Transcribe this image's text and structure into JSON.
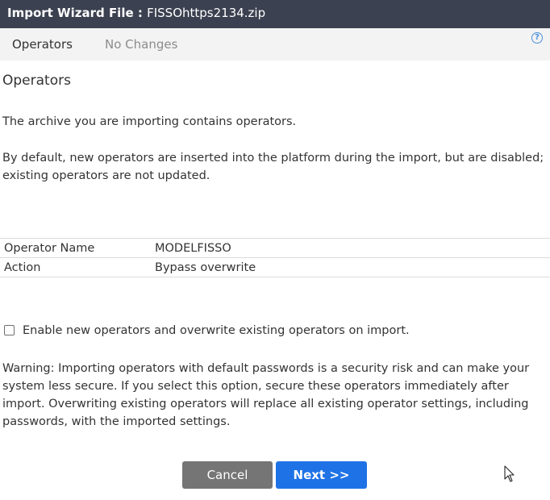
{
  "window": {
    "title_prefix": "Import Wizard File : ",
    "file_name": "FISSOhttps2134.zip"
  },
  "tabs": [
    {
      "label": "Operators",
      "state": "active"
    },
    {
      "label": "No Changes",
      "state": "inactive"
    }
  ],
  "help_icon": {
    "glyph": "?",
    "icon": "help-circle-icon"
  },
  "section": {
    "heading": "Operators",
    "intro": "The archive you are importing contains operators.",
    "default_behavior": "By default, new operators are inserted into the platform during the import, but are disabled; existing operators are not updated."
  },
  "operator_table": {
    "rows": [
      {
        "label": "Operator Name",
        "value": "MODELFISSO"
      },
      {
        "label": "Action",
        "value": "Bypass overwrite"
      }
    ]
  },
  "enable_option": {
    "label": "Enable new operators and overwrite existing operators on import.",
    "checked": false
  },
  "warning": "Warning: Importing operators with default passwords is a security risk and can make your system less secure. If you select this option, secure these operators immediately after import. Overwriting existing operators will replace all existing operator settings, including passwords, with the imported settings.",
  "buttons": {
    "cancel": "Cancel",
    "next": "Next >>"
  },
  "colors": {
    "title_bar": "#3b4150",
    "tabs_bar": "#f3f3f3",
    "cancel_button": "#757575",
    "next_button": "#1f72e6",
    "help_icon": "#4a8fd8"
  }
}
